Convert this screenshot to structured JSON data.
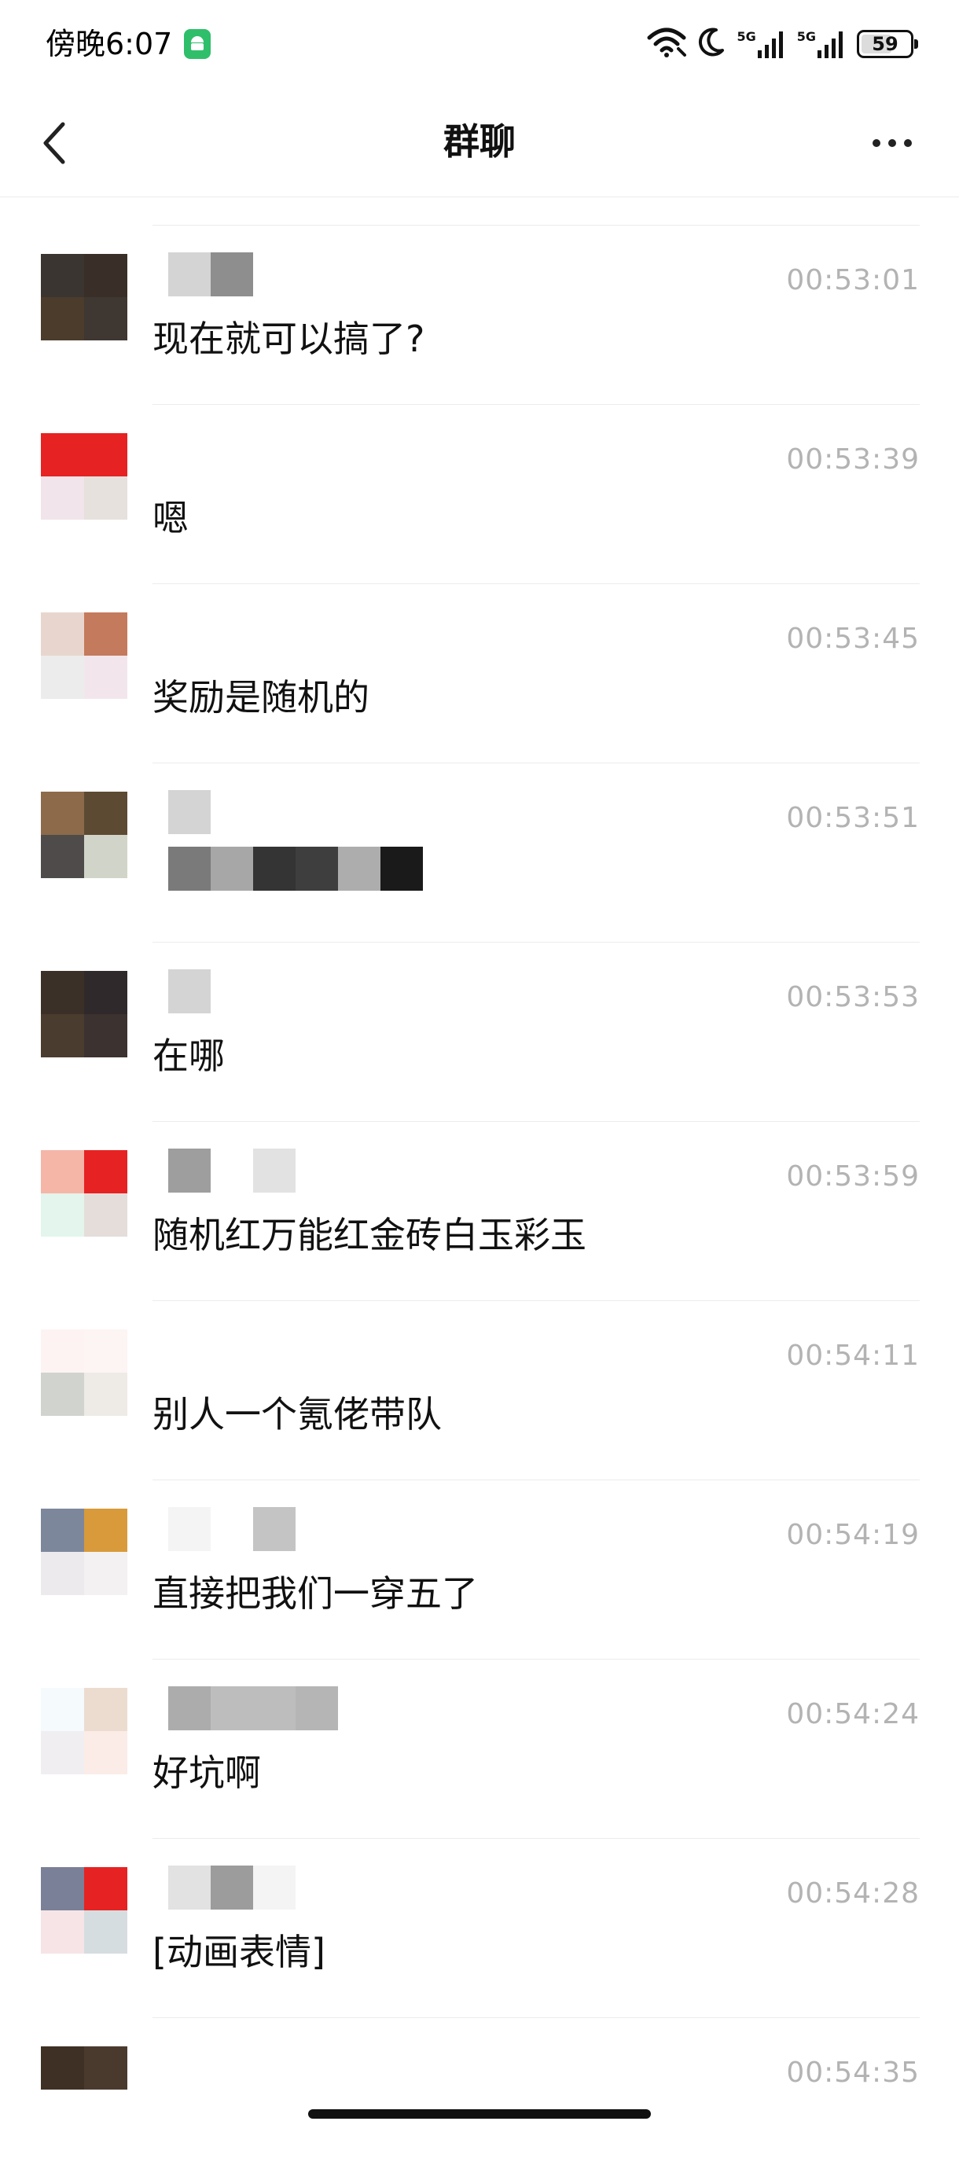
{
  "status_bar": {
    "time": "傍晚6:07",
    "network_1": "5G",
    "network_2": "5G",
    "battery": "59",
    "icons": [
      "android-notification-icon",
      "wifi-icon",
      "moon-icon",
      "signal-icon",
      "signal-icon",
      "battery-icon"
    ]
  },
  "header": {
    "title": "群聊",
    "back_icon": "chevron-left-icon",
    "more_icon": "more-dots-icon"
  },
  "messages": [
    {
      "time": "00:53:01",
      "text": "现在就可以搞了?",
      "avatar_colors": [
        "#3b3532",
        "#3a2f28",
        "#4b3c2c",
        "#3f3731"
      ],
      "sender_blur": [
        "#d4d4d4",
        "#8e8e8e"
      ]
    },
    {
      "time": "00:53:39",
      "text": "嗯",
      "avatar_colors": [
        "#e62222",
        "#e62222",
        "#f1e4ea",
        "#e6e1dd"
      ],
      "sender_blur": []
    },
    {
      "time": "00:53:45",
      "text": "奖励是随机的",
      "avatar_colors": [
        "#e8d6ce",
        "#c47a5c",
        "#ececec",
        "#f2e6ec"
      ],
      "sender_blur": []
    },
    {
      "time": "00:53:51",
      "text": "",
      "avatar_colors": [
        "#8c6a4a",
        "#5d4a32",
        "#4e4b4a",
        "#d1d4c8"
      ],
      "sender_blur": [
        "#d4d4d4"
      ],
      "text_blur": [
        "#7a7a7a",
        "#a7a7a7",
        "#343434",
        "#3e3e3e",
        "#adadad",
        "#1a1a1a"
      ]
    },
    {
      "time": "00:53:53",
      "text": "在哪",
      "avatar_colors": [
        "#3a3028",
        "#30292b",
        "#4a3c2e",
        "#3c3230"
      ],
      "sender_blur": [
        "#d4d4d4"
      ]
    },
    {
      "time": "00:53:59",
      "text": "随机红万能红金砖白玉彩玉",
      "avatar_colors": [
        "#f5b6a8",
        "#e62222",
        "#e3f5ec",
        "#e4ddda"
      ],
      "sender_blur": [
        "#9e9e9e",
        "#ffffff",
        "#e2e2e2"
      ]
    },
    {
      "time": "00:54:11",
      "text": "别人一个氪佬带队",
      "avatar_colors": [
        "#fdf3f3",
        "#fdf4f4",
        "#d1d3cf",
        "#eeebe6"
      ],
      "sender_blur": []
    },
    {
      "time": "00:54:19",
      "text": "直接把我们一穿五了",
      "avatar_colors": [
        "#7d879c",
        "#d89a3a",
        "#eceaec",
        "#f3f1f2"
      ],
      "sender_blur": [
        "#f4f4f4",
        "#ffffff",
        "#c4c4c4"
      ]
    },
    {
      "time": "00:54:24",
      "text": "好坑啊",
      "avatar_colors": [
        "#f5fbfc",
        "#ecdcd0",
        "#f1eef2",
        "#fbece8"
      ],
      "sender_blur": [
        "#acacac",
        "#bdbdbd",
        "#bdbdbd",
        "#b5b5b5"
      ]
    },
    {
      "time": "00:54:28",
      "text": "[动画表情]",
      "avatar_colors": [
        "#7a8098",
        "#e62222",
        "#f6e4e6",
        "#d6dde0"
      ],
      "sender_blur": [
        "#e2e2e2",
        "#9c9c9c",
        "#f4f4f4"
      ]
    },
    {
      "time": "00:54:35",
      "text": "",
      "avatar_colors": [
        "#3e3024",
        "#4a3a2e",
        "#ffffff",
        "#ffffff"
      ],
      "sender_blur": []
    }
  ]
}
